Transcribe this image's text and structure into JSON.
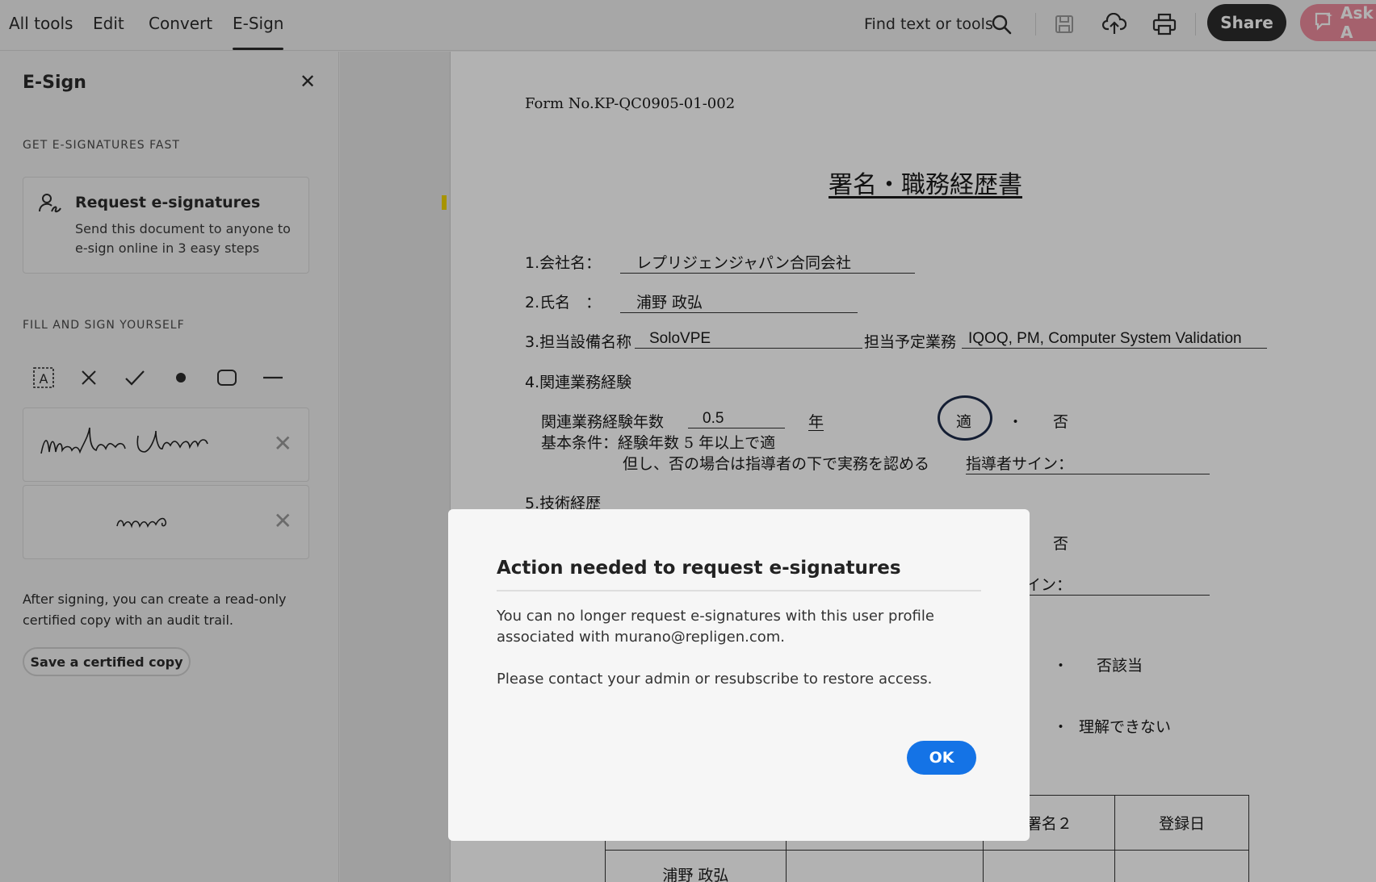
{
  "topbar": {
    "tabs": [
      "All tools",
      "Edit",
      "Convert",
      "E-Sign"
    ],
    "active_tab": "E-Sign",
    "find_label": "Find text or tools",
    "share_label": "Share",
    "ask_label": "Ask A"
  },
  "panel": {
    "title": "E-Sign",
    "section_fast": "GET E-SIGNATURES FAST",
    "request_title": "Request e-signatures",
    "request_desc": "Send this document to anyone to e-sign online in 3 easy steps",
    "section_fill": "FILL AND SIGN YOURSELF",
    "tools": [
      "text-field-icon",
      "cross-mark-icon",
      "check-mark-icon",
      "dot-icon",
      "rounded-rect-icon",
      "line-icon"
    ],
    "after_text": "After signing, you can create a read-only certified copy with an audit trail.",
    "certified_label": "Save a certified copy"
  },
  "document": {
    "form_no": "Form No.KP-QC0905-01-002",
    "doc_title": "署名・職務経歴書",
    "company_label": "1.会社名：",
    "company_value": "レプリジェンジャパン合同会社",
    "name_label": "2.氏名　：",
    "name_value": "浦野 政弘",
    "equipment_label": "3.担当設備名称",
    "equipment_value": "SoloVPE",
    "duty_label": "担当予定業務",
    "duty_value": "IQOQ, PM, Computer System Validation",
    "section4": "4.関連業務経験",
    "years_label": "関連業務経験年数",
    "years_value": "0.5",
    "years_unit": "年",
    "ok_mark": "適",
    "dot": "・",
    "ng_mark": "否",
    "basic_condition": "基本条件：経験年数 5 年以上で適",
    "proviso": "但し、否の場合は指導者の下で実務を認める",
    "mentor_sign": "指導者サイン：",
    "section5": "5.技術経歴",
    "ng_mark2": "否",
    "sign_partial": "イン：",
    "not_applicable": "否該当",
    "dot2": "・",
    "dot3": "・",
    "not_understand": "理解できない",
    "table_sign2": "署名２",
    "table_date": "登録日",
    "table_row_name": "浦野 政弘"
  },
  "dialog": {
    "title": "Action needed to request e-signatures",
    "body1": "You can no longer request e-signatures with this user profile associated with murano@repligen.com.",
    "body2": "Please contact your admin or resubscribe to restore access.",
    "ok_label": "OK"
  }
}
